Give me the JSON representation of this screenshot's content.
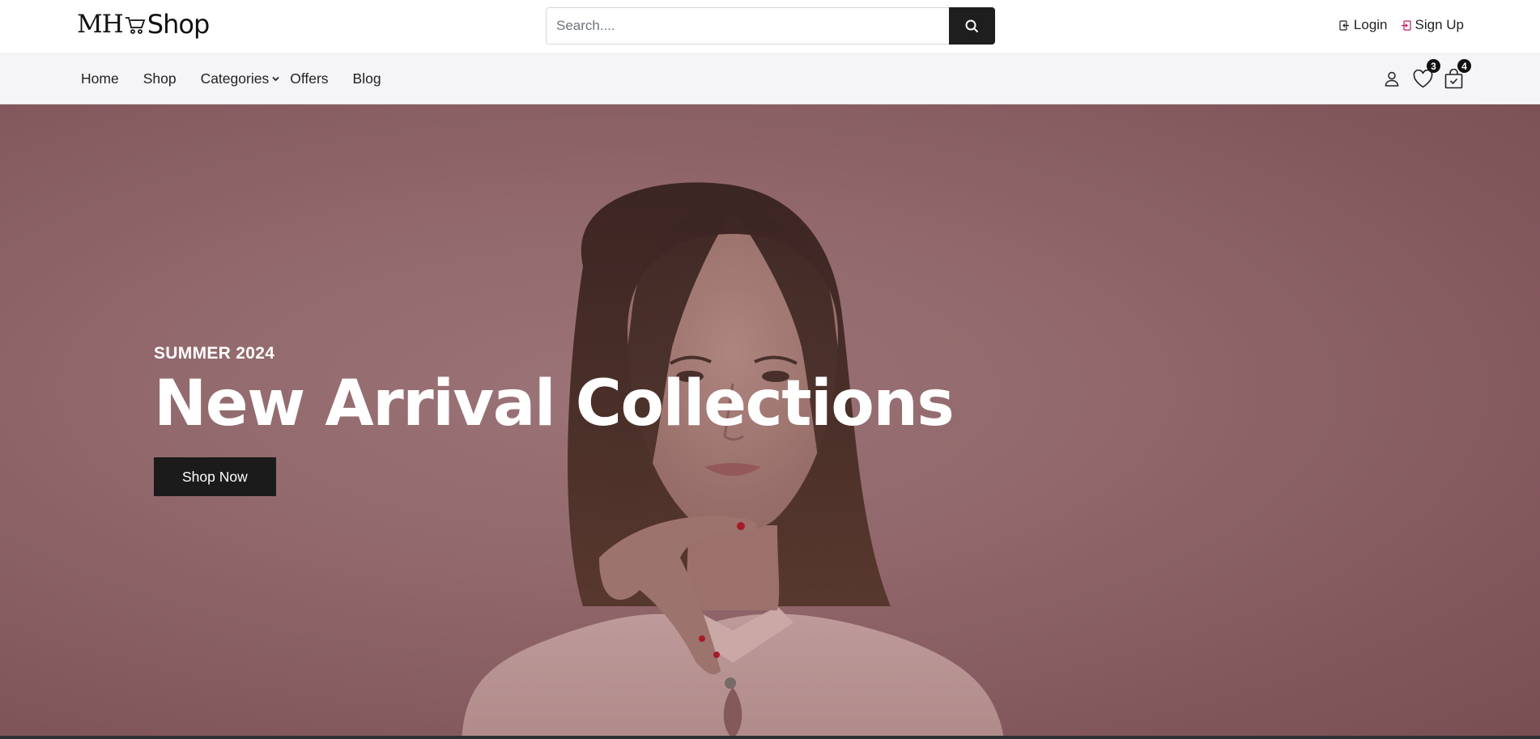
{
  "brand": {
    "mark": "MH",
    "name": "Shop"
  },
  "search": {
    "placeholder": "Search...."
  },
  "auth": {
    "login": "Login",
    "signup": "Sign Up"
  },
  "nav": {
    "home": "Home",
    "shop": "Shop",
    "categories": "Categories",
    "offers": "Offers",
    "blog": "Blog"
  },
  "icons": {
    "wishlist_count": "3",
    "cart_count": "4"
  },
  "hero": {
    "eyebrow": "SUMMER 2024",
    "title": "New Arrival Collections",
    "cta": "Shop Now"
  },
  "colors": {
    "dark": "#1e1e1e",
    "navbar_bg": "#f5f5f7",
    "hero_bg": "#9a6f72"
  }
}
